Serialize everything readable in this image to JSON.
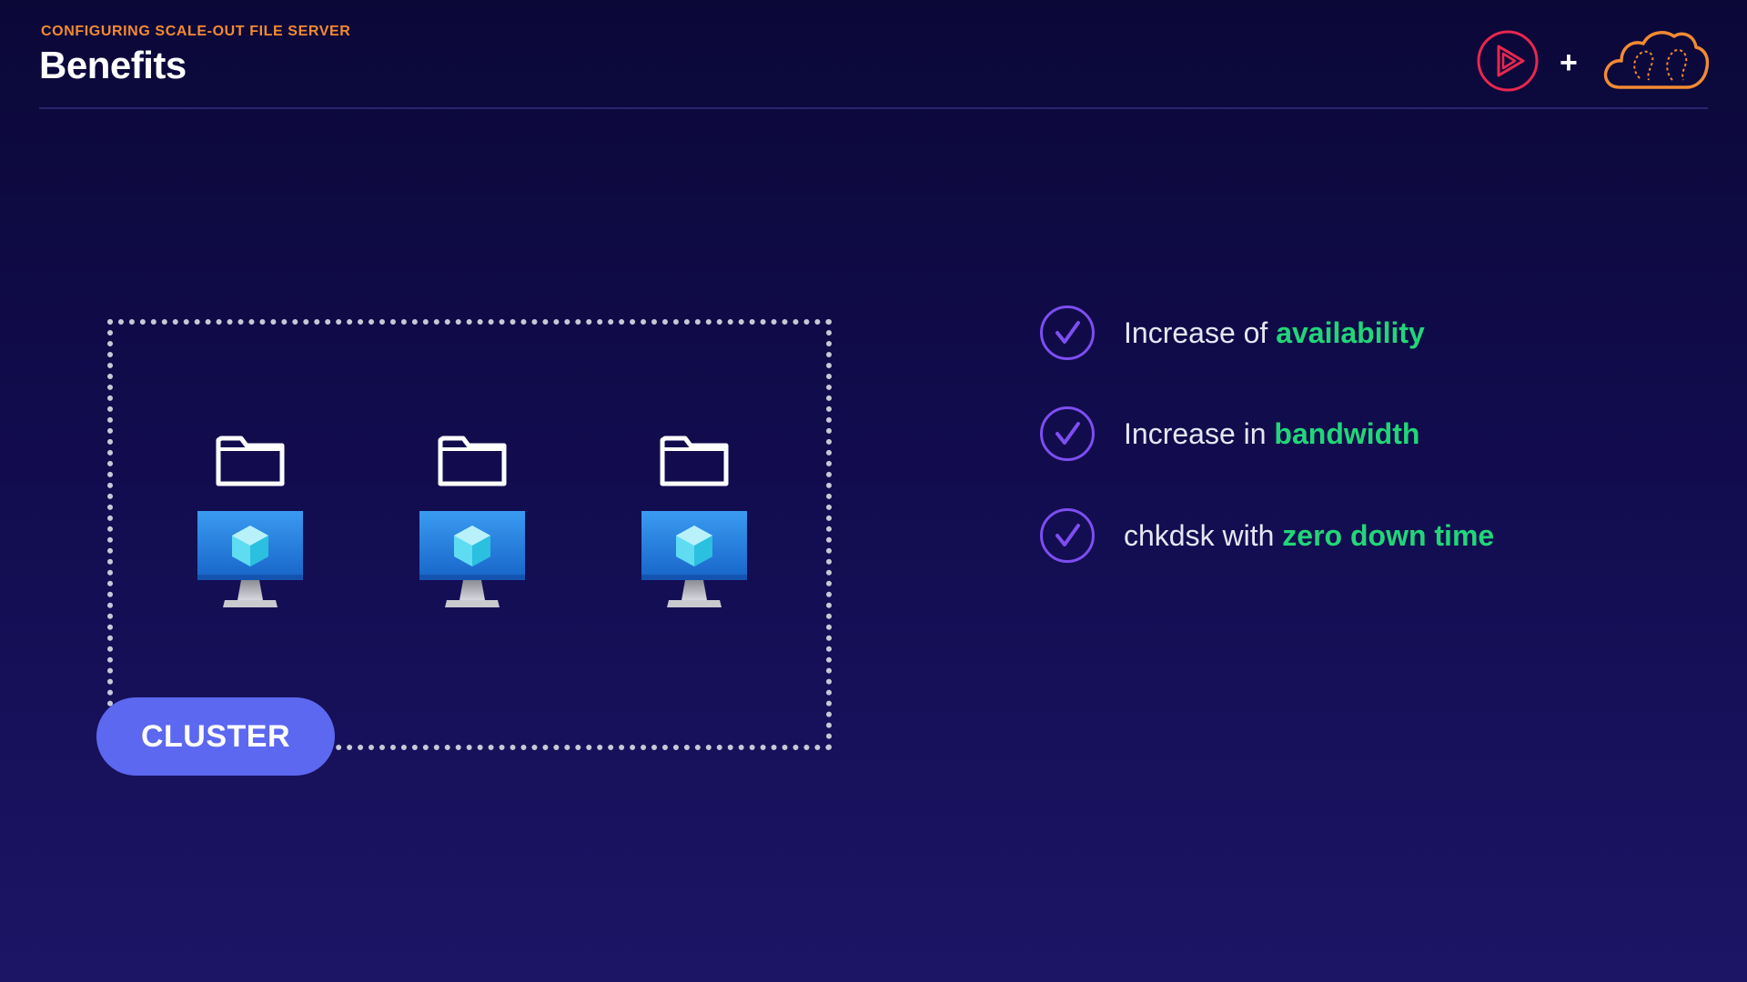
{
  "header": {
    "kicker": "CONFIGURING SCALE-OUT FILE SERVER",
    "title": "Benefits",
    "plus": "+",
    "logos": [
      "play-logo-icon",
      "cloud-brain-logo-icon"
    ]
  },
  "diagram": {
    "cluster_label": "CLUSTER",
    "nodes": [
      {
        "icons": [
          "folder-icon",
          "server-monitor-icon"
        ]
      },
      {
        "icons": [
          "folder-icon",
          "server-monitor-icon"
        ]
      },
      {
        "icons": [
          "folder-icon",
          "server-monitor-icon"
        ]
      }
    ]
  },
  "benefits": [
    {
      "icon": "checkmark-icon",
      "text": "Increase of ",
      "highlight": "availability"
    },
    {
      "icon": "checkmark-icon",
      "text": "Increase in ",
      "highlight": "bandwidth"
    },
    {
      "icon": "checkmark-icon",
      "text": "chkdsk with ",
      "highlight": "zero down time"
    }
  ],
  "colors": {
    "accent_orange": "#f28a34",
    "highlight_green": "#22d678",
    "check_purple": "#7d4ef0",
    "pill_blue": "#5c68f0",
    "logo_red": "#e8274f"
  }
}
